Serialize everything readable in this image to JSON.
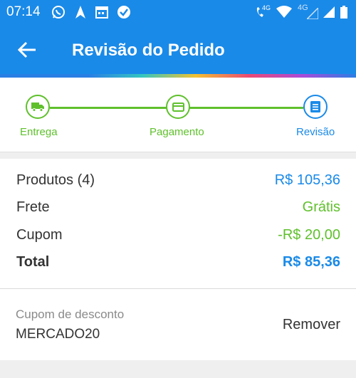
{
  "status_bar": {
    "time": "07:14",
    "icons": [
      "whatsapp-icon",
      "location-arrow-icon",
      "calendar-icon",
      "check-circle-icon"
    ],
    "right_icons": [
      "volte-4g-icon",
      "wifi-icon",
      "4g-signal-icon",
      "signal-icon",
      "battery-icon"
    ],
    "network_label_1": "4G",
    "network_label_2": "4G"
  },
  "toolbar": {
    "title": "Revisão do Pedido"
  },
  "colors": {
    "primary": "#1a8ae8",
    "green": "#5fc02c",
    "blue_text": "#1a8ae8"
  },
  "steps": [
    {
      "label": "Entrega",
      "icon": "truck-icon",
      "state": "done"
    },
    {
      "label": "Pagamento",
      "icon": "card-icon",
      "state": "done"
    },
    {
      "label": "Revisão",
      "icon": "list-icon",
      "state": "current"
    }
  ],
  "summary": {
    "products_label": "Produtos (4)",
    "products_value": "R$ 105,36",
    "shipping_label": "Frete",
    "shipping_value": "Grátis",
    "coupon_label": "Cupom",
    "coupon_value": "-R$ 20,00",
    "total_label": "Total",
    "total_value": "R$ 85,36"
  },
  "coupon": {
    "field_label": "Cupom de desconto",
    "code": "MERCADO20",
    "remove_label": "Remover"
  }
}
